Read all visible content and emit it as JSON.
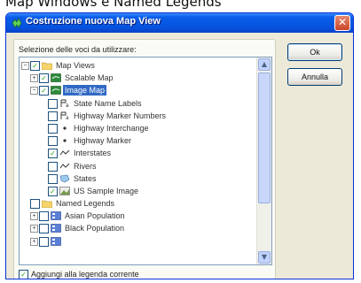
{
  "caption": "Map Windows e Named Legends",
  "dialog": {
    "title": "Costruzione nuova Map View",
    "close_glyph": "✕",
    "list_label": "Selezione delle voci da utilizzare:",
    "buttons": {
      "ok": "Ok",
      "cancel": "Annulla"
    },
    "footer_checkbox": {
      "label": "Aggiungi alla legenda corrente",
      "checked": true
    }
  },
  "tree": [
    {
      "label": "Map Views",
      "level": 0,
      "expander": "-",
      "checked": true,
      "icon": "folder-icon",
      "selected": false
    },
    {
      "label": "Scalable Map",
      "level": 1,
      "expander": "+",
      "checked": true,
      "icon": "map-icon",
      "selected": false
    },
    {
      "label": "Image Map",
      "level": 1,
      "expander": "-",
      "checked": true,
      "icon": "map-icon",
      "selected": true
    },
    {
      "label": "State Name Labels",
      "level": 2,
      "expander": "",
      "checked": false,
      "icon": "label-layer-icon",
      "selected": false
    },
    {
      "label": "Highway Marker Numbers",
      "level": 2,
      "expander": "",
      "checked": false,
      "icon": "label-layer-icon",
      "selected": false
    },
    {
      "label": "Highway Interchange",
      "level": 2,
      "expander": "",
      "checked": false,
      "icon": "point-layer-icon",
      "selected": false
    },
    {
      "label": "Highway Marker",
      "level": 2,
      "expander": "",
      "checked": false,
      "icon": "point-layer-icon",
      "selected": false
    },
    {
      "label": "Interstates",
      "level": 2,
      "expander": "",
      "checked": true,
      "icon": "line-layer-icon",
      "selected": false
    },
    {
      "label": "Rivers",
      "level": 2,
      "expander": "",
      "checked": false,
      "icon": "line-layer-icon",
      "selected": false
    },
    {
      "label": "States",
      "level": 2,
      "expander": "",
      "checked": false,
      "icon": "polygon-layer-icon",
      "selected": false
    },
    {
      "label": "US Sample Image",
      "level": 2,
      "expander": "",
      "checked": true,
      "icon": "image-layer-icon",
      "selected": false
    },
    {
      "label": "Named Legends",
      "level": 0,
      "expander": "",
      "checked": false,
      "icon": "folder-icon",
      "selected": false
    },
    {
      "label": "Asian Population",
      "level": 1,
      "expander": "+",
      "checked": false,
      "icon": "legend-icon",
      "selected": false
    },
    {
      "label": "Black Population",
      "level": 1,
      "expander": "+",
      "checked": false,
      "icon": "legend-icon",
      "selected": false
    },
    {
      "label": "",
      "level": 1,
      "expander": "+",
      "checked": false,
      "icon": "legend-icon",
      "selected": false
    }
  ],
  "colors": {
    "title_bar": "#0553e0",
    "selection": "#316ac5",
    "check_mark": "#21a121",
    "dialog_face": "#ece9d8"
  }
}
